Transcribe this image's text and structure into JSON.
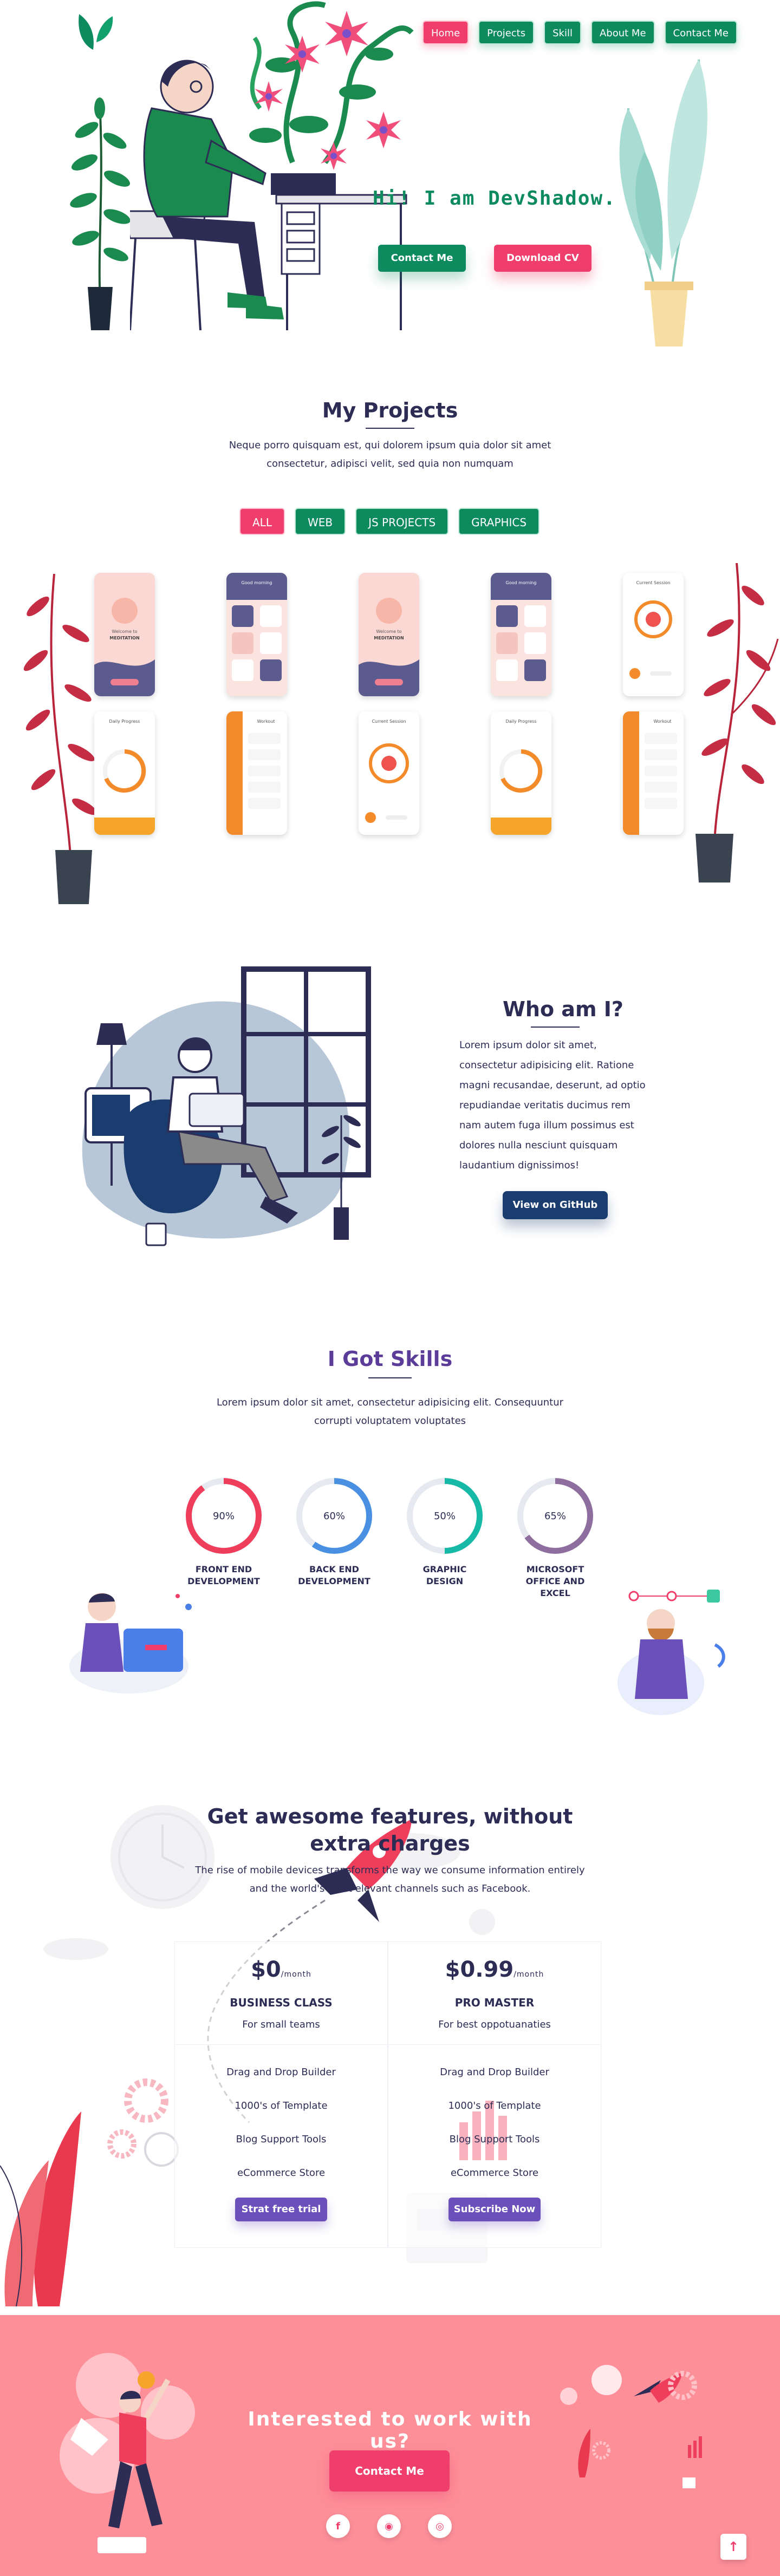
{
  "nav": {
    "items": [
      {
        "label": "Home",
        "active": true
      },
      {
        "label": "Projects",
        "active": false
      },
      {
        "label": "Skill",
        "active": false
      },
      {
        "label": "About Me",
        "active": false
      },
      {
        "label": "Contact Me",
        "active": false
      }
    ]
  },
  "hero": {
    "title": "Hi! I am DevShadow.",
    "contact_button": "Contact Me",
    "download_button": "Download CV"
  },
  "projects": {
    "title": "My Projects",
    "subtitle": "Neque porro quisquam est, qui dolorem ipsum quia dolor sit amet consectetur, adipisci velit, sed quia non numquam",
    "filters": [
      "ALL",
      "WEB",
      "JS PROJECTS",
      "GRAPHICS"
    ],
    "active_filter": "ALL",
    "cards": [
      {
        "title": "Welcome to",
        "subtitle": "MEDITATION"
      },
      {
        "title": "Good morning",
        "subtitle": ""
      },
      {
        "title": "Welcome to",
        "subtitle": "MEDITATION"
      },
      {
        "title": "Good morning",
        "subtitle": ""
      },
      {
        "title": "Current Session",
        "subtitle": ""
      },
      {
        "title": "Daily Progress",
        "subtitle": ""
      },
      {
        "title": "Workout",
        "subtitle": ""
      },
      {
        "title": "Current Session",
        "subtitle": ""
      },
      {
        "title": "Daily Progress",
        "subtitle": ""
      },
      {
        "title": "Workout",
        "subtitle": ""
      }
    ]
  },
  "about": {
    "title": "Who am I?",
    "text": "Lorem ipsum dolor sit amet, consectetur adipisicing elit. Ratione magni recusandae, deserunt, ad optio repudiandae veritatis ducimus rem nam autem fuga illum possimus est dolores nulla nesciunt quisquam laudantium dignissimos!",
    "button": "View on GitHub"
  },
  "skills": {
    "title": "I Got Skills",
    "subtitle": "Lorem ipsum dolor sit amet, consectetur adipisicing elit. Consequuntur corrupti voluptatem voluptates",
    "items": [
      {
        "percent": "90%",
        "value": 0.9,
        "name": "FRONT END DEVELOPMENT",
        "color": "#ef3e5c"
      },
      {
        "percent": "60%",
        "value": 0.6,
        "name": "BACK END DEVELOPMENT",
        "color": "#4a90e2"
      },
      {
        "percent": "50%",
        "value": 0.5,
        "name": "GRAPHIC DESIGN",
        "color": "#16b8a6"
      },
      {
        "percent": "65%",
        "value": 0.65,
        "name": "MICROSOFT OFFICE AND EXCEL",
        "color": "#8e6e9e"
      }
    ]
  },
  "pricing": {
    "title": "Get awesome features, without extra charges",
    "subtitle": "The rise of mobile devices transforms the way we consume information entirely and the world's most elevant channels such as Facebook.",
    "plans": [
      {
        "price": "$0",
        "period": "/month",
        "name": "BUSINESS CLASS",
        "desc": "For small teams",
        "features": [
          "Drag and Drop Builder",
          "1000's of Template",
          "Blog Support Tools",
          "eCommerce Store"
        ],
        "button": "Strat free trial"
      },
      {
        "price": "$0.99",
        "period": "/month",
        "name": "PRO MASTER",
        "desc": "For best oppotuanaties",
        "features": [
          "Drag and Drop Builder",
          "1000's of Template",
          "Blog Support Tools",
          "eCommerce Store"
        ],
        "button": "Subscribe Now"
      }
    ]
  },
  "footer": {
    "title": "Interested to work with us?",
    "button": "Contact Me",
    "socials": [
      {
        "icon": "facebook-icon",
        "glyph": "f"
      },
      {
        "icon": "github-icon",
        "glyph": "◉"
      },
      {
        "icon": "instagram-icon",
        "glyph": "◎"
      }
    ],
    "to_top": "↑"
  },
  "colors": {
    "green": "#0e8a5f",
    "pink": "#ef3e6b",
    "navy": "#1a3c6e",
    "purple": "#6b4fbb",
    "footer_bg": "#fd8f99"
  }
}
